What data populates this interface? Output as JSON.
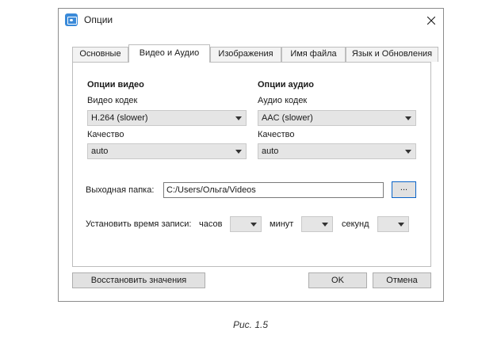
{
  "window": {
    "title": "Опции"
  },
  "tabs": [
    {
      "label": "Основные"
    },
    {
      "label": "Видео и Аудио",
      "active": true
    },
    {
      "label": "Изображения"
    },
    {
      "label": "Имя файла"
    },
    {
      "label": "Язык и Обновления"
    }
  ],
  "video": {
    "title": "Опции видео",
    "codec_label": "Видео кодек",
    "codec_value": "H.264 (slower)",
    "quality_label": "Качество",
    "quality_value": "auto"
  },
  "audio": {
    "title": "Опции аудио",
    "codec_label": "Аудио кодек",
    "codec_value": "AAC (slower)",
    "quality_label": "Качество",
    "quality_value": "auto"
  },
  "output": {
    "label": "Выходная папка:",
    "path": "C:/Users/Ольга/Videos",
    "browse_label": "..."
  },
  "timer": {
    "label": "Установить время записи:",
    "hours_label": "часов",
    "minutes_label": "минут",
    "seconds_label": "секунд",
    "hours_value": "",
    "minutes_value": "",
    "seconds_value": ""
  },
  "buttons": {
    "restore": "Восстановить значения",
    "ok": "OK",
    "cancel": "Отмена"
  },
  "caption": "Рис. 1.5",
  "icons": {
    "app": "camera-app-icon",
    "close": "close-icon",
    "dropdown": "chevron-down-icon"
  }
}
